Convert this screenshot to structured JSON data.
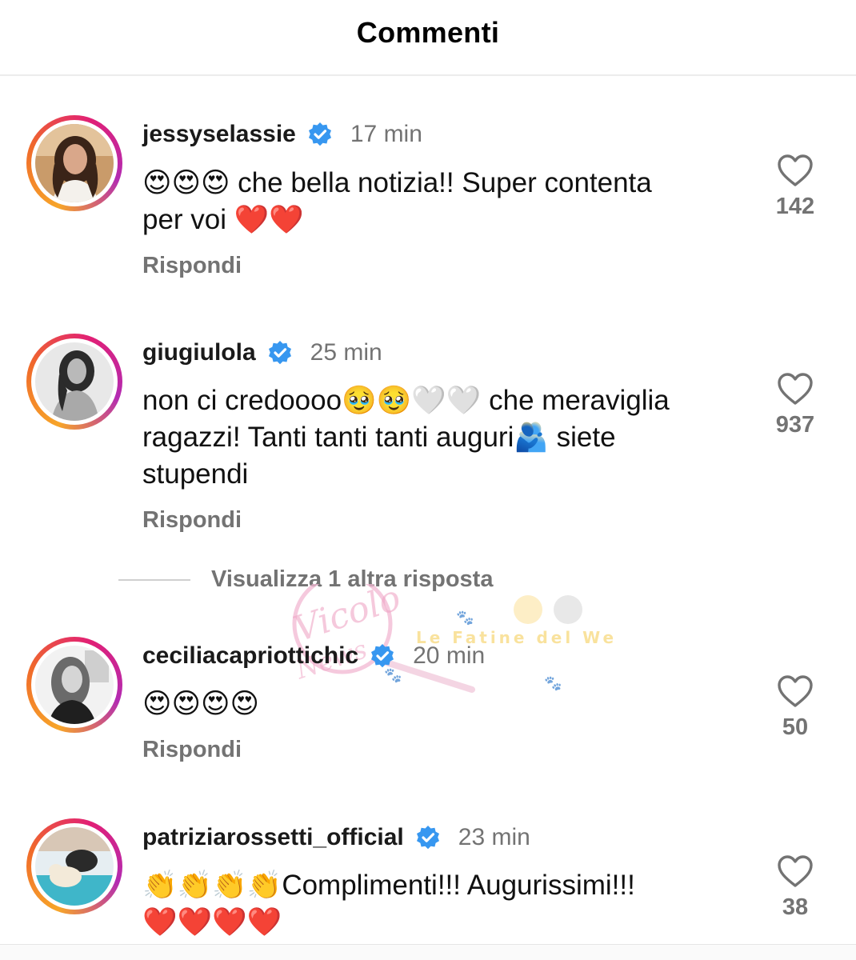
{
  "header": {
    "title": "Commenti"
  },
  "comments": [
    {
      "username": "jessyselassie",
      "time": "17 min",
      "text_line1": "😍😍😍 che bella notizia!! Super contenta",
      "text_line2": "per voi ❤️❤️",
      "text_line3": "",
      "reply": "Rispondi",
      "likes": "142"
    },
    {
      "username": "giugiulola",
      "time": "25 min",
      "text_line1": "non ci credoooo🥹🥹🤍🤍 che meraviglia",
      "text_line2": "ragazzi! Tanti tanti tanti auguri🫂 siete",
      "text_line3": "stupendi",
      "reply": "Rispondi",
      "likes": "937"
    },
    {
      "username": "ceciliacapriottichic",
      "time": "20 min",
      "text_line1": "😍😍😍😍",
      "text_line2": "",
      "text_line3": "",
      "reply": "Rispondi",
      "likes": "50"
    },
    {
      "username": "patriziarossetti_official",
      "time": "23 min",
      "text_line1": "👏👏👏👏Complimenti!!! Augurissimi!!!",
      "text_line2": "❤️❤️❤️❤️",
      "text_line3": "",
      "reply": "",
      "likes": "38"
    }
  ],
  "view_replies": "Visualizza 1 altra risposta",
  "watermark": {
    "brand": "Vicolo delle News",
    "subtitle": "Le Fatine del Web"
  },
  "colors": {
    "verified": "#3797f0",
    "muted": "#737373",
    "accent_pink": "#e11f75",
    "accent_orange": "#f7a529"
  },
  "icons": {
    "like": "heart-outline-icon",
    "verified": "verified-badge-icon"
  }
}
